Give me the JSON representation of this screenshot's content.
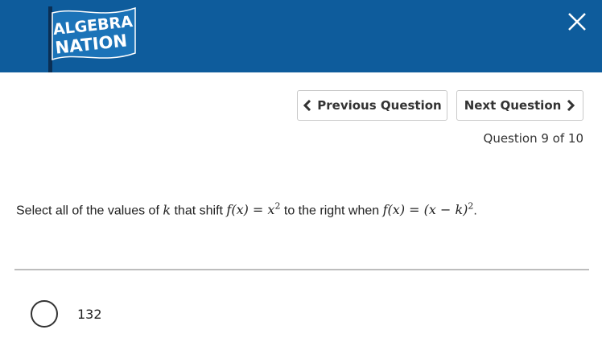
{
  "header": {
    "logo_text_line1": "ALGEBRA",
    "logo_text_line2": "NATION",
    "brand_color": "#0e5c9c",
    "close_icon": "close-icon"
  },
  "navigation": {
    "previous_label": "Previous Question",
    "next_label": "Next Question",
    "counter": "Question 9 of 10"
  },
  "question": {
    "text_before_k": "Select all of the values of ",
    "variable": "k",
    "text_mid1": " that shift ",
    "expr1": "f(x) = x",
    "exp1": "2",
    "text_mid2": " to the right when ",
    "expr2": "f(x) = (x − k)",
    "exp2": "2",
    "text_end": "."
  },
  "options": [
    {
      "label": "132"
    }
  ]
}
